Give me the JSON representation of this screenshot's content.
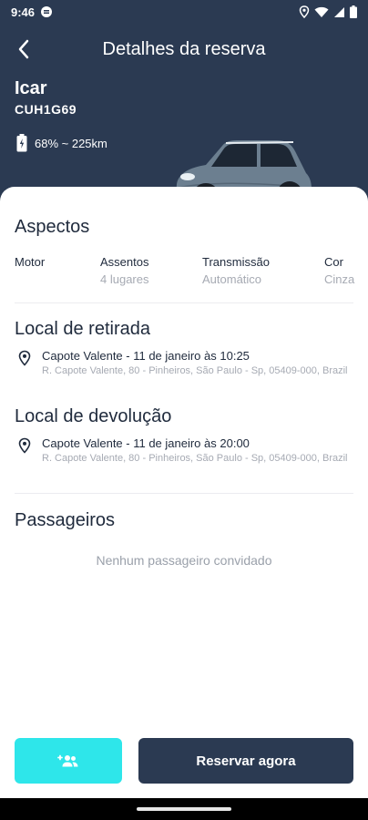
{
  "status_bar": {
    "time": "9:46"
  },
  "header": {
    "title": "Detalhes da reserva",
    "car_name": "Icar",
    "plate": "CUH1G69",
    "battery": "68% ~ 225km"
  },
  "aspects": {
    "title": "Aspectos",
    "items": [
      {
        "label": "Motor",
        "value": ""
      },
      {
        "label": "Assentos",
        "value": "4 lugares"
      },
      {
        "label": "Transmissão",
        "value": "Automático"
      },
      {
        "label": "Cor",
        "value": "Cinza"
      }
    ]
  },
  "pickup": {
    "title": "Local de retirada",
    "main": "Capote Valente - 11 de janeiro às 10:25",
    "address": "R. Capote Valente, 80 - Pinheiros, São Paulo - Sp, 05409-000, Brazil"
  },
  "dropoff": {
    "title": "Local de devolução",
    "main": "Capote Valente - 11 de janeiro às 20:00",
    "address": "R. Capote Valente, 80 - Pinheiros, São Paulo - Sp, 05409-000, Brazil"
  },
  "passengers": {
    "title": "Passageiros",
    "empty_text": "Nenhum passageiro convidado"
  },
  "actions": {
    "reserve_label": "Reservar agora",
    "invite_icon": "add-group-icon"
  },
  "colors": {
    "header_bg": "#2b3a52",
    "accent": "#2ee6ea",
    "primary_button": "#2b3a52"
  }
}
